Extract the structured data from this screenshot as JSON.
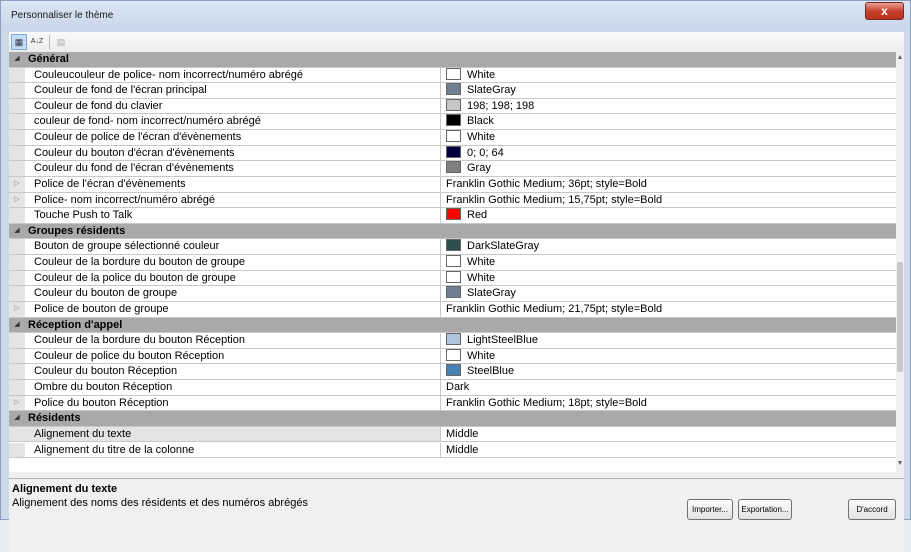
{
  "window": {
    "title": "Personnaliser le thème",
    "close_label": "x"
  },
  "toolbar": {
    "categorized_label": "▦",
    "alpha_label": "A↓Z",
    "pages_label": "▤"
  },
  "rows": [
    {
      "type": "cat",
      "name": "Général"
    },
    {
      "type": "prop",
      "name": "Couleucouleur de police- nom incorrect/numéro abrégé",
      "value": "White",
      "swatch": "#ffffff"
    },
    {
      "type": "prop",
      "name": "Couleur de fond de l'écran principal",
      "value": "SlateGray",
      "swatch": "#708090"
    },
    {
      "type": "prop",
      "name": "Couleur de fond du clavier",
      "value": "198; 198; 198",
      "swatch": "#c6c6c6"
    },
    {
      "type": "prop",
      "name": "couleur de fond- nom incorrect/numéro abrégé",
      "value": "Black",
      "swatch": "#000000"
    },
    {
      "type": "prop",
      "name": "Couleur de police de l'écran d'évènements",
      "value": "White",
      "swatch": "#ffffff"
    },
    {
      "type": "prop",
      "name": "Couleur du bouton d'écran d'évènements",
      "value": "0; 0; 64",
      "swatch": "#000040"
    },
    {
      "type": "prop",
      "name": "Couleur du fond de l'écran d'évènements",
      "value": "Gray",
      "swatch": "#808080"
    },
    {
      "type": "prop",
      "expand": true,
      "name": "Police de l'écran d'évènements",
      "value": "Franklin Gothic Medium; 36pt; style=Bold"
    },
    {
      "type": "prop",
      "expand": true,
      "name": "Police- nom incorrect/numéro abrégé",
      "value": "Franklin Gothic Medium; 15,75pt; style=Bold"
    },
    {
      "type": "prop",
      "name": "Touche Push to Talk",
      "value": "Red",
      "swatch": "#ff0000"
    },
    {
      "type": "cat",
      "name": "Groupes résidents"
    },
    {
      "type": "prop",
      "name": "Bouton de groupe sélectionné couleur",
      "value": "DarkSlateGray",
      "swatch": "#2f4f4f"
    },
    {
      "type": "prop",
      "name": "Couleur de la bordure du bouton de groupe",
      "value": "White",
      "swatch": "#ffffff"
    },
    {
      "type": "prop",
      "name": "Couleur de la police du bouton de groupe",
      "value": "White",
      "swatch": "#ffffff"
    },
    {
      "type": "prop",
      "name": "Couleur du bouton de groupe",
      "value": "SlateGray",
      "swatch": "#708090"
    },
    {
      "type": "prop",
      "expand": true,
      "name": "Police de bouton de groupe",
      "value": "Franklin Gothic Medium; 21,75pt; style=Bold"
    },
    {
      "type": "cat",
      "name": "Réception d'appel"
    },
    {
      "type": "prop",
      "name": "Couleur de la bordure du bouton Réception",
      "value": "LightSteelBlue",
      "swatch": "#b0c4de"
    },
    {
      "type": "prop",
      "name": "Couleur de police du bouton Réception",
      "value": "White",
      "swatch": "#ffffff"
    },
    {
      "type": "prop",
      "name": "Couleur du bouton Réception",
      "value": "SteelBlue",
      "swatch": "#4682b4"
    },
    {
      "type": "prop",
      "name": "Ombre du bouton Réception",
      "value": "Dark"
    },
    {
      "type": "prop",
      "expand": true,
      "name": "Police du bouton Réception",
      "value": "Franklin Gothic Medium; 18pt; style=Bold"
    },
    {
      "type": "cat",
      "name": "Résidents"
    },
    {
      "type": "prop",
      "selected": true,
      "name": "Alignement du texte",
      "value": "Middle"
    },
    {
      "type": "prop",
      "name": "Alignement du titre de la colonne",
      "value": "Middle"
    }
  ],
  "description": {
    "title": "Alignement du texte",
    "text": "Alignement des noms des résidents et des numéros abrégés"
  },
  "buttons": {
    "import": "Importer...",
    "export": "Exportation...",
    "ok": "D'accord"
  }
}
